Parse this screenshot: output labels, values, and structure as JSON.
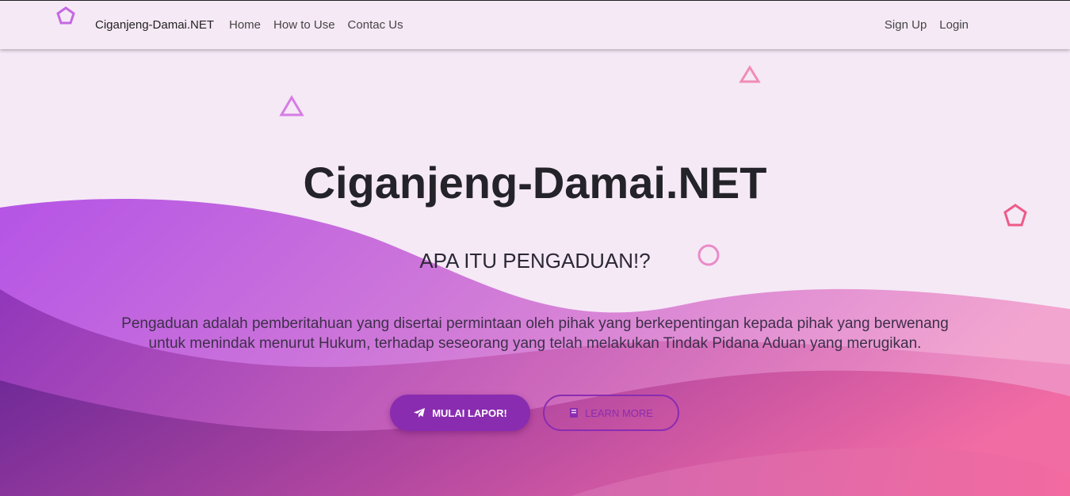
{
  "navbar": {
    "brand": "Ciganjeng-Damai.NET",
    "links": [
      {
        "label": "Home"
      },
      {
        "label": "How to Use"
      },
      {
        "label": "Contac Us"
      }
    ],
    "right_links": [
      {
        "label": "Sign Up"
      },
      {
        "label": "Login"
      }
    ],
    "logo_icon": "pentagon-logo-icon"
  },
  "hero": {
    "title": "Ciganjeng-Damai.NET",
    "subtitle": "APA ITU PENGADUAN!?",
    "description_line1": "Pengaduan adalah pemberitahuan yang disertai permintaan oleh pihak yang berkepentingan kepada pihak yang berwenang",
    "description_line2": "untuk menindak menurut Hukum, terhadap seseorang yang telah melakukan Tindak Pidana Aduan yang merugikan."
  },
  "buttons": {
    "primary": {
      "label": "MULAI LAPOR!",
      "icon": "paper-plane-icon"
    },
    "secondary": {
      "label": "LEARN MORE",
      "icon": "book-icon"
    }
  },
  "colors": {
    "background": "#f5e9f6",
    "accent": "#8a2cb0",
    "wave_purple": "#b554e6",
    "wave_pink": "#f06ea8"
  }
}
